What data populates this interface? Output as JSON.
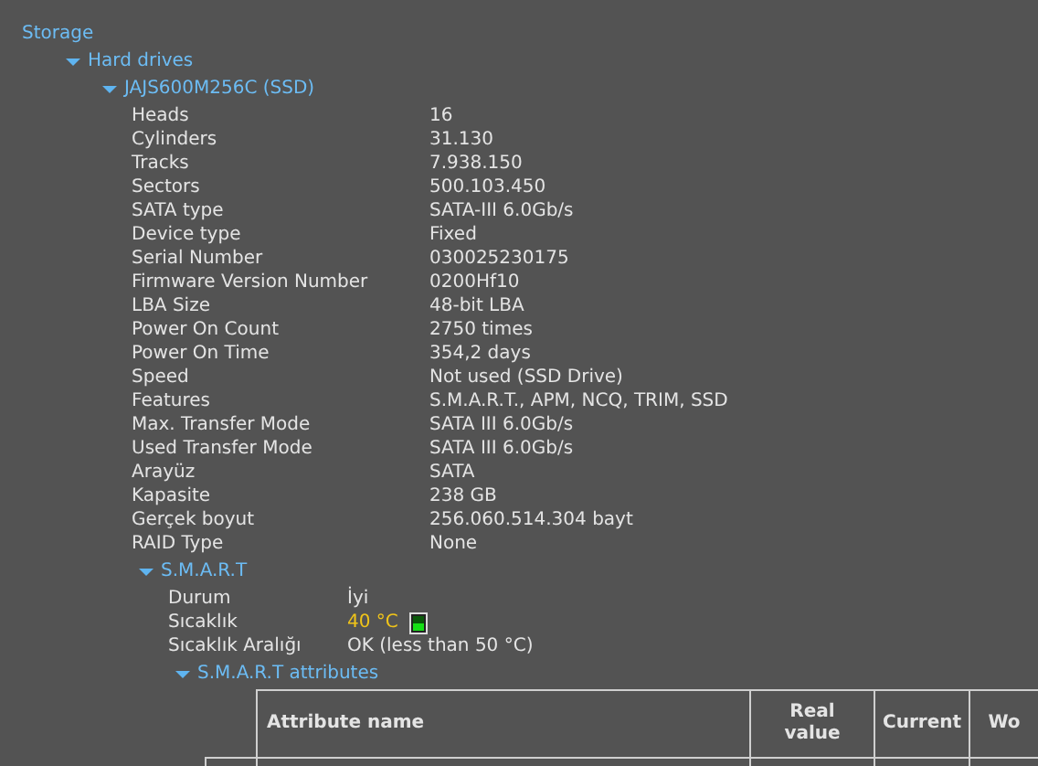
{
  "tree": {
    "label": "Storage",
    "children": [
      {
        "label": "Hard drives",
        "expanded": true,
        "children": [
          {
            "label": "JAJS600M256C (SSD)",
            "expanded": true,
            "properties": [
              {
                "name": "Heads",
                "value": "16"
              },
              {
                "name": "Cylinders",
                "value": "31.130"
              },
              {
                "name": "Tracks",
                "value": "7.938.150"
              },
              {
                "name": "Sectors",
                "value": "500.103.450"
              },
              {
                "name": "SATA type",
                "value": "SATA-III 6.0Gb/s"
              },
              {
                "name": "Device type",
                "value": "Fixed"
              },
              {
                "name": "Serial Number",
                "value": "030025230175"
              },
              {
                "name": "Firmware Version Number",
                "value": "0200Hf10"
              },
              {
                "name": "LBA Size",
                "value": "48-bit LBA"
              },
              {
                "name": "Power On Count",
                "value": "2750 times"
              },
              {
                "name": "Power On Time",
                "value": "354,2 days"
              },
              {
                "name": "Speed",
                "value": "Not used (SSD Drive)"
              },
              {
                "name": "Features",
                "value": "S.M.A.R.T., APM, NCQ, TRIM, SSD"
              },
              {
                "name": "Max. Transfer Mode",
                "value": "SATA III 6.0Gb/s"
              },
              {
                "name": "Used Transfer Mode",
                "value": "SATA III 6.0Gb/s"
              },
              {
                "name": "Arayüz",
                "value": "SATA"
              },
              {
                "name": "Kapasite",
                "value": "238 GB"
              },
              {
                "name": "Gerçek boyut",
                "value": "256.060.514.304 bayt"
              },
              {
                "name": "RAID Type",
                "value": "None"
              }
            ],
            "children": [
              {
                "label": "S.M.A.R.T",
                "expanded": true,
                "properties": [
                  {
                    "name": "Durum",
                    "value": "İyi"
                  },
                  {
                    "name": "Sıcaklık",
                    "value": "40 °C",
                    "color": "#f0c419",
                    "meter": true
                  },
                  {
                    "name": "Sıcaklık Aralığı",
                    "value": "OK (less than 50 °C)"
                  }
                ],
                "children": [
                  {
                    "label": "S.M.A.R.T attributes",
                    "expanded": true,
                    "table": {
                      "columns": [
                        "Attribute name",
                        "Real value",
                        "Current",
                        "Wo"
                      ]
                    }
                  }
                ]
              }
            ]
          }
        ]
      }
    ]
  }
}
